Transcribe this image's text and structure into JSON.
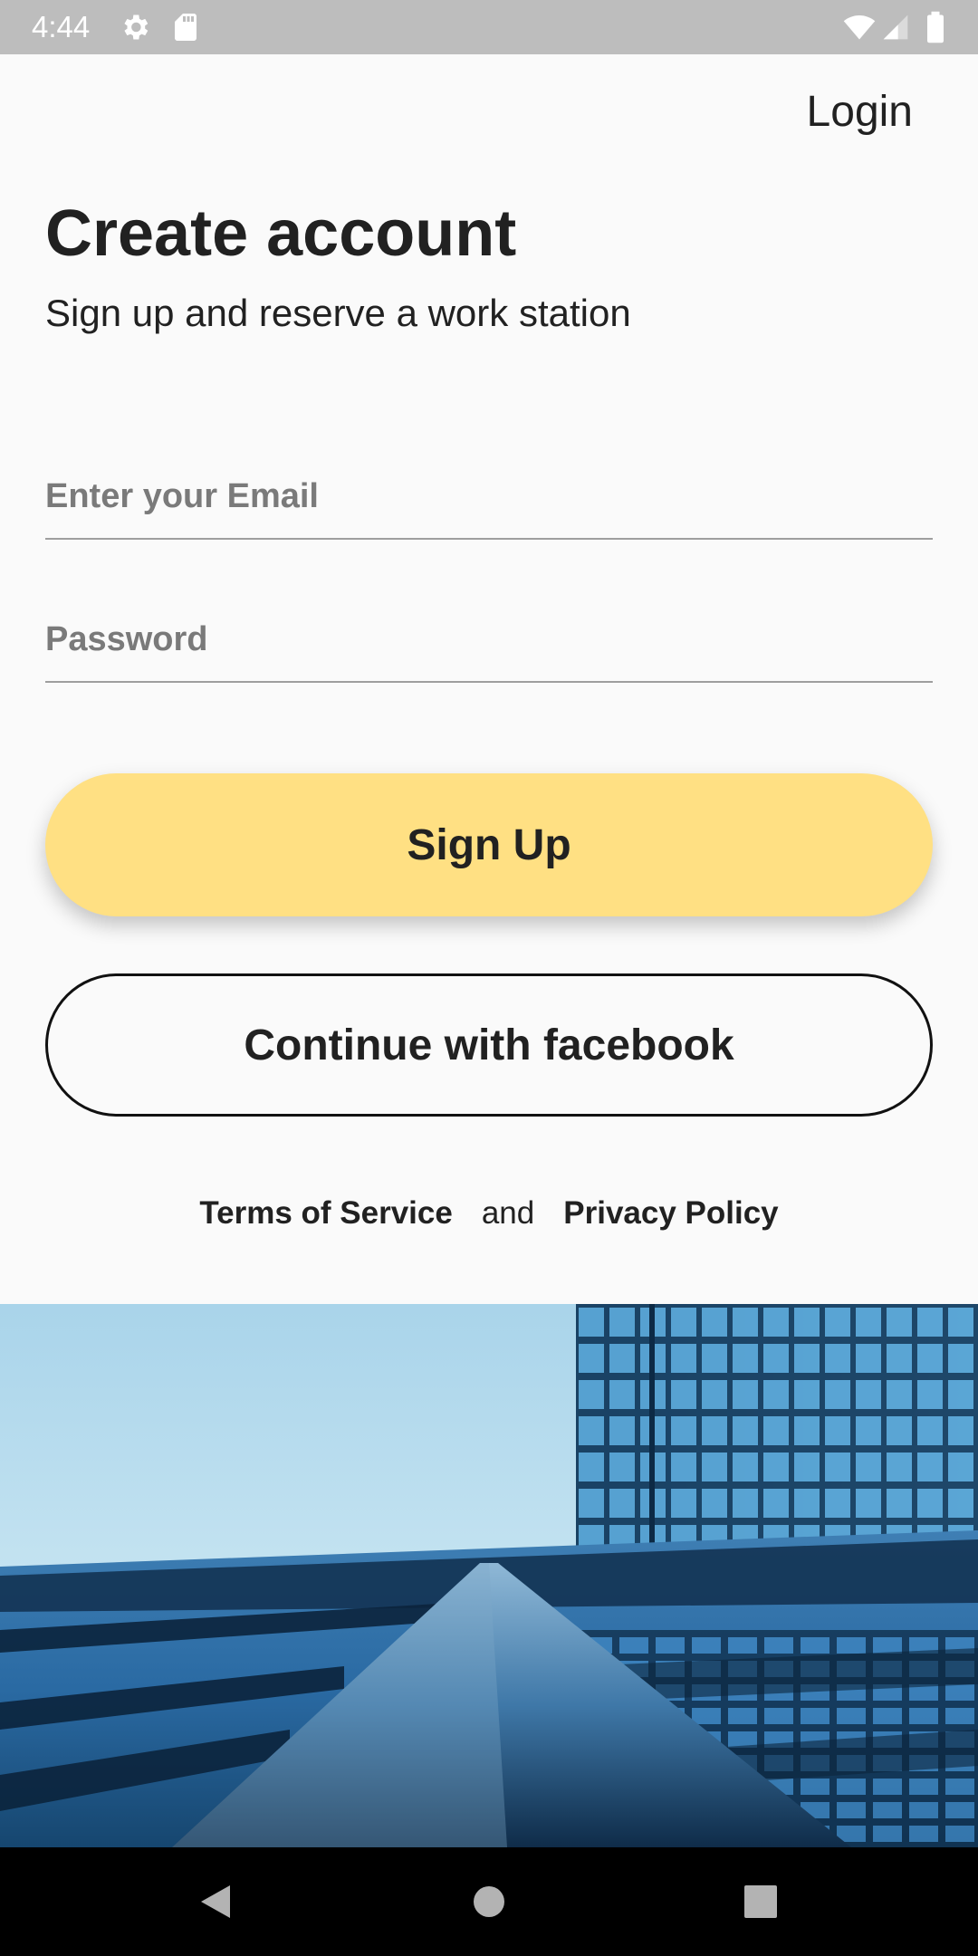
{
  "status_bar": {
    "time": "4:44",
    "icons": [
      "settings-icon",
      "sd-card-icon",
      "wifi-icon",
      "signal-icon",
      "battery-icon"
    ]
  },
  "header": {
    "login_label": "Login"
  },
  "main": {
    "title": "Create account",
    "subtitle": "Sign up and reserve a work station",
    "email": {
      "placeholder": "Enter your Email",
      "value": ""
    },
    "password": {
      "placeholder": "Password",
      "value": ""
    },
    "signup_label": "Sign Up",
    "facebook_label": "Continue with facebook"
  },
  "legal": {
    "terms_label": "Terms of Service",
    "and_label": "and",
    "privacy_label": "Privacy Policy"
  },
  "hero": {
    "subject": "glass-office-building-photo"
  },
  "nav_bar": {
    "icons": [
      "back-icon",
      "home-icon",
      "recents-icon"
    ]
  },
  "colors": {
    "status_bar": "#bdbdbd",
    "background": "#fafafa",
    "primary_button": "#ffe083",
    "text": "#212121",
    "nav_bar": "#000000"
  }
}
